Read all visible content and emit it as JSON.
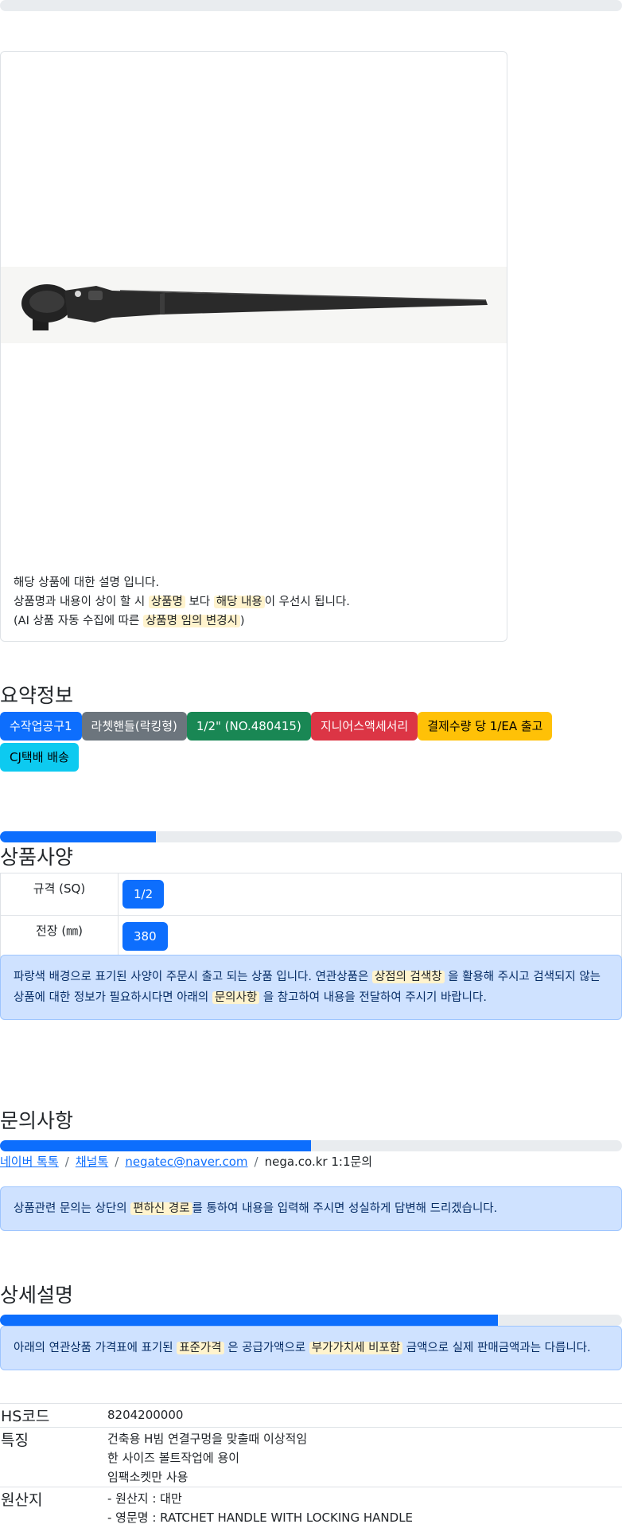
{
  "top_progress": {
    "percent": 0
  },
  "product": {
    "image_alt": "라쳇핸들(락킹형)",
    "notice_line1": "해당 상품에 대한 설명 입니다.",
    "notice_line2_a": "상품명과 내용이 상이 할 시",
    "notice_line2_hl1": "상품명",
    "notice_line2_b": "보다",
    "notice_line2_hl2": "해당 내용",
    "notice_line2_c": "이 우선시 됩니다.",
    "notice_line3_a": "(AI 상품 자동 수집에 따른",
    "notice_line3_hl": "상품명 임의 변경시",
    "notice_line3_b": ")"
  },
  "summary": {
    "title": "요약정보",
    "badges": [
      {
        "label": "수작업공구1",
        "color": "#0d6efd",
        "text": "#ffffff"
      },
      {
        "label": "라쳇핸들(락킹형)",
        "color": "#6c757d",
        "text": "#ffffff"
      },
      {
        "label": "1/2\" (NO.480415)",
        "color": "#198754",
        "text": "#ffffff"
      },
      {
        "label": "지니어스액세서리",
        "color": "#dc3545",
        "text": "#ffffff"
      },
      {
        "label": "결제수량 당 1/EA 출고",
        "color": "#ffc107",
        "text": "#000000"
      },
      {
        "label": "CJ택배 배송",
        "color": "#0dcaf0",
        "text": "#000000"
      }
    ]
  },
  "specs": {
    "progress_percent": 25,
    "title": "상품사양",
    "rows": [
      {
        "key": "규격 (SQ)",
        "value": "1/2"
      },
      {
        "key": "전장 (㎜)",
        "value": "380"
      }
    ],
    "alert_a": "파랑색 배경으로 표기된 사양이 주문시 출고 되는 상품 입니다. 연관상품은",
    "alert_hl1": "상점의 검색창",
    "alert_b": "을 활용해 주시고 검색되지 않는 상품에 대한 정보가 필요하시다면 아래의",
    "alert_hl2": "문의사항",
    "alert_c": "을 참고하여 내용을 전달하여 주시기 바랍니다."
  },
  "inquiry": {
    "title": "문의사항",
    "progress_percent": 50,
    "links": [
      "네이버 톡톡",
      "채널톡",
      "negatec@naver.com"
    ],
    "last": "nega.co.kr 1:1문의",
    "alert_a": "상품관련 문의는 상단의",
    "alert_hl": "편하신 경로",
    "alert_b": "를 통하여 내용을 입력해 주시면 성실하게 답변해 드리겠습니다."
  },
  "detail": {
    "title": "상세설명",
    "progress_percent": 80,
    "alert_a": "아래의 연관상품 가격표에 표기된",
    "alert_hl1": "표준가격",
    "alert_b": "은 공급가액으로",
    "alert_hl2": "부가가치세 비포함",
    "alert_c": "금액으로 실제 판매금액과는 다릅니다.",
    "rows": [
      {
        "key": "HS코드",
        "lines": [
          "8204200000"
        ]
      },
      {
        "key": "특징",
        "lines": [
          "건축용 H빔 연결구멍을 맞출때 이상적임",
          "한 사이즈 볼트작업에 용이",
          "임팩소켓만 사용"
        ]
      },
      {
        "key": "원산지",
        "lines": [
          "- 원산지 : 대만",
          "- 영문명 : RATCHET HANDLE WITH LOCKING HANDLE"
        ]
      }
    ]
  }
}
